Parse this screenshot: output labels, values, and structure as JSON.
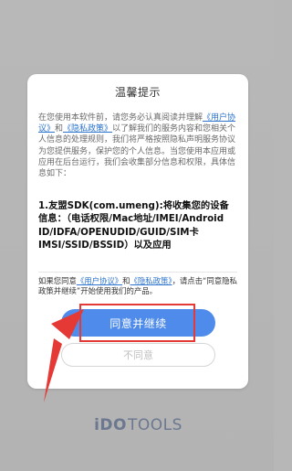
{
  "dialog": {
    "title": "温馨提示",
    "intro": {
      "part1": "在您使用本软件前，请您务必认真阅读并理解",
      "link1": "《用户协议》",
      "part2": "和",
      "link2": "《隐私政策》",
      "part3": "以了解我们的服务内容和您相关个人信息的处理规则，我们将严格按照隐私声明服务协议为您提供服务，保护您的个人信息。当您使用本应用或应用在后台运行，我们会收集部分信息和权限，具体信息如下："
    },
    "sdk_text": "1.友盟SDK(com.umeng):将收集您的设备信息：（电话权限/Mac地址/IMEI/Android ID/IDFA/OPENUDID/GUID/SIM卡IMSI/SSID/BSSID）以及应用"
  },
  "agreement_note": {
    "part1": "如果您同意",
    "link1": "《用户协议》",
    "part2": "和",
    "link2": "《隐私政策》",
    "part3": "，请点击“同意隐私政策并继续”开始使用我们的产品。"
  },
  "buttons": {
    "agree": "同意并继续",
    "disagree": "不同意"
  },
  "logo": {
    "text_ido": "iDO",
    "text_tools": "TOOLS"
  },
  "colors": {
    "primary": "#4f8bea",
    "link": "#2b73cc",
    "annotation": "#e53935"
  }
}
